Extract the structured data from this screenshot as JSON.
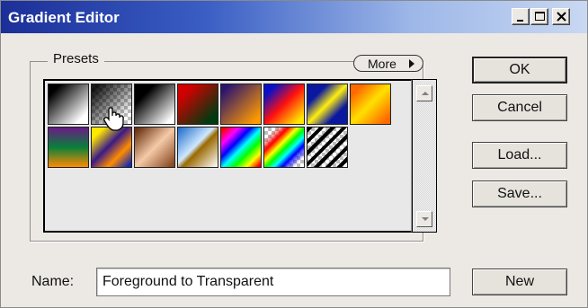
{
  "window": {
    "title": "Gradient Editor"
  },
  "titlebar_buttons": [
    "minimize-icon",
    "maximize-icon",
    "close-icon"
  ],
  "presets": {
    "label": "Presets",
    "more_label": "More",
    "swatches": [
      {
        "name": "black-white"
      },
      {
        "name": "transparent-checker"
      },
      {
        "name": "black-white-2"
      },
      {
        "name": "red-green"
      },
      {
        "name": "violet-orange"
      },
      {
        "name": "blue-red-yellow"
      },
      {
        "name": "blue-yellow-blue"
      },
      {
        "name": "orange-yellow-orange"
      },
      {
        "name": "violet-green-orange"
      },
      {
        "name": "yellow-violet-orange-blue"
      },
      {
        "name": "copper"
      },
      {
        "name": "chrome"
      },
      {
        "name": "spectrum"
      },
      {
        "name": "transparent-rainbow"
      },
      {
        "name": "transparent-stripes"
      }
    ]
  },
  "buttons": {
    "ok": "OK",
    "cancel": "Cancel",
    "load": "Load...",
    "save": "Save...",
    "new": "New"
  },
  "name_field": {
    "label": "Name:",
    "value": "Foreground to Transparent"
  }
}
